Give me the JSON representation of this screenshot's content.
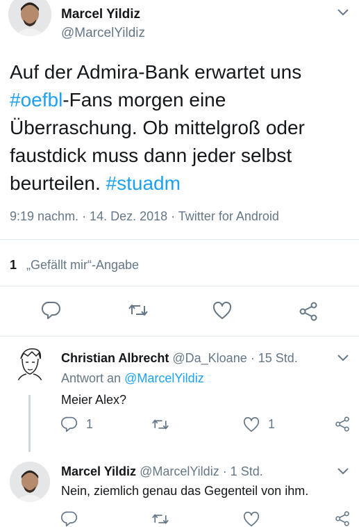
{
  "main_tweet": {
    "author_name": "Marcel Yildiz",
    "author_handle": "@MarcelYildiz",
    "text_parts": [
      "Auf der Admira-Bank erwartet uns ",
      "#oefbl",
      "-Fans morgen eine Überraschung. Ob mittelgroß oder faustdick muss dann jeder selbst beurteilen. ",
      "#stuadm"
    ],
    "meta": "9:19 nachm. · 14. Dez. 2018 · Twitter for Android",
    "likes_count": "1",
    "likes_label": "„Gefällt mir“-Angabe"
  },
  "replies": [
    {
      "author_name": "Christian Albrecht",
      "handle_time": "@Da_Kloane · 15 Std.",
      "reply_prefix": "Antwort an",
      "reply_to": "@MarcelYildiz",
      "text": "Meier Alex?",
      "reply_count": "1",
      "like_count": "1"
    },
    {
      "author_name": "Marcel Yildiz",
      "handle_time": "@MarcelYildiz · 1 Std.",
      "text": "Nein, ziemlich genau das Gegenteil von ihm."
    }
  ],
  "colors": {
    "link": "#1da1f2",
    "muted": "#657786",
    "icon": "#657786",
    "text": "#14171a"
  },
  "icons": [
    "chevron-down-icon",
    "reply-icon",
    "retweet-icon",
    "like-icon",
    "share-icon"
  ]
}
